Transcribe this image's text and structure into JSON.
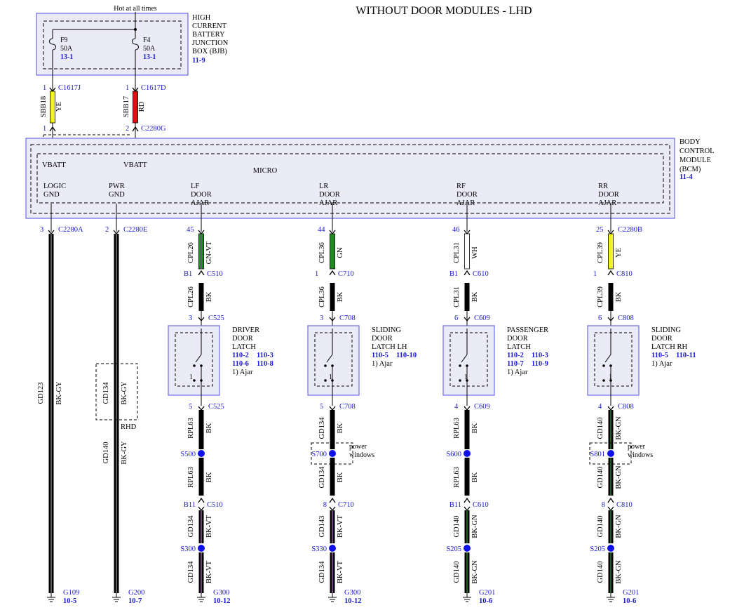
{
  "title": "WITHOUT DOOR MODULES - LHD",
  "hot_label": "Hot at all times",
  "colors": {
    "box_border": "#6a6ae6",
    "box_fill": "#ebebf7",
    "text_blue": "#1a1ad0",
    "splice": "#1010ee"
  },
  "bjb": {
    "name": [
      "HIGH",
      "CURRENT",
      "BATTERY",
      "JUNCTION",
      "BOX (BJB)"
    ],
    "ref": "11-9",
    "fuses": [
      {
        "id": "F9",
        "rating": "50A",
        "ref": "13-1"
      },
      {
        "id": "F4",
        "rating": "50A",
        "ref": "13-1"
      }
    ]
  },
  "feeds": [
    {
      "pin_top": "1",
      "conn_top": "C1617J",
      "circuit": "SBB18",
      "color": "YE",
      "pin_bot": "1",
      "conn_bot": ""
    },
    {
      "pin_top": "1",
      "conn_top": "C1617D",
      "circuit": "SBB17",
      "color": "RD",
      "pin_bot": "2",
      "conn_bot": "C2280G"
    }
  ],
  "bcm": {
    "name": [
      "BODY",
      "CONTROL",
      "MODULE",
      "(BCM)"
    ],
    "ref": "11-4",
    "micro": "MICRO",
    "vbatt": [
      "VBATT",
      "VBATT"
    ],
    "pins": [
      [
        "LOGIC",
        "GND"
      ],
      [
        "PWR",
        "GND"
      ],
      [
        "LF",
        "DOOR",
        "AJAR"
      ],
      [
        "LR",
        "DOOR",
        "AJAR"
      ],
      [
        "RF",
        "DOOR",
        "AJAR"
      ],
      [
        "RR",
        "DOOR",
        "AJAR"
      ]
    ]
  },
  "grounds": [
    {
      "pin": "3",
      "conn": "C2280A",
      "circuit": "GD123",
      "color": "BK-GY",
      "ground": "G109",
      "ref": "10-5"
    },
    {
      "pin": "2",
      "conn": "C2280E",
      "circuit": "GD140",
      "color": "BK-GY",
      "rhd_circuit": "GD134",
      "rhd_color": "BK-GY",
      "rhd_label": "RHD",
      "ground": "G200",
      "ref": "10-7"
    }
  ],
  "columns": [
    {
      "bcm_pin": "45",
      "bcm_wire": {
        "circuit": "CPL26",
        "color": "GN-VT"
      },
      "c1_pin": "B1",
      "c1": "C510",
      "w2": {
        "circuit": "CPL26",
        "color": "BK"
      },
      "latch_pin_top": "3",
      "latch_conn": "C525",
      "latch_name": [
        "DRIVER",
        "DOOR",
        "LATCH"
      ],
      "latch_refs": [
        [
          "110-2",
          "110-3"
        ],
        [
          "110-6",
          "110-8"
        ]
      ],
      "ajar_note": "1) Ajar",
      "switch_label": "1",
      "latch_pin_bot": "5",
      "latch_conn_bot": "C525",
      "w3": {
        "circuit": "RPL63",
        "color": "BK"
      },
      "splice": "S500",
      "splice_note": "",
      "w4": {
        "circuit": "RPL63",
        "color": "BK"
      },
      "c2_pin": "B11",
      "c2": "C510",
      "w5": {
        "circuit": "GD134",
        "color": "BK-VT"
      },
      "splice2": "S300",
      "w6": {
        "circuit": "GD134",
        "color": "BK-VT"
      },
      "ground": "G300",
      "ground_ref": "10-12"
    },
    {
      "bcm_pin": "44",
      "bcm_wire": {
        "circuit": "CPL36",
        "color": "GN"
      },
      "c1_pin": "1",
      "c1": "C710",
      "w2": {
        "circuit": "CPL36",
        "color": "BK"
      },
      "latch_pin_top": "3",
      "latch_conn": "C708",
      "latch_name": [
        "SLIDING",
        "DOOR",
        "LATCH LH"
      ],
      "latch_refs": [
        [
          "110-5",
          "110-10"
        ]
      ],
      "ajar_note": "1) Ajar",
      "switch_label": "1",
      "latch_pin_bot": "5",
      "latch_conn_bot": "C708",
      "w3": {
        "circuit": "GD134",
        "color": "BK"
      },
      "splice": "S700",
      "splice_note": [
        "power",
        "windows"
      ],
      "w4": {
        "circuit": "GD134",
        "color": "BK"
      },
      "c2_pin": "8",
      "c2": "C710",
      "w5": {
        "circuit": "GD143",
        "color": "BK-VT"
      },
      "splice2": "S330",
      "w6": {
        "circuit": "GD134",
        "color": "BK-VT"
      },
      "ground": "G300",
      "ground_ref": "10-12"
    },
    {
      "bcm_pin": "46",
      "bcm_wire": {
        "circuit": "CPL31",
        "color": "WH"
      },
      "c1_pin": "B1",
      "c1": "C610",
      "w2": {
        "circuit": "CPL31",
        "color": "BK"
      },
      "latch_pin_top": "6",
      "latch_conn": "C609",
      "latch_name": [
        "PASSENGER",
        "DOOR",
        "LATCH"
      ],
      "latch_refs": [
        [
          "110-2",
          "110-3"
        ],
        [
          "110-7",
          "110-9"
        ]
      ],
      "ajar_note": "1) Ajar",
      "switch_label": "1",
      "latch_pin_bot": "4",
      "latch_conn_bot": "C609",
      "w3": {
        "circuit": "RPL63",
        "color": "BK"
      },
      "splice": "S600",
      "splice_note": "",
      "w4": {
        "circuit": "RPL63",
        "color": "BK"
      },
      "c2_pin": "B11",
      "c2": "C610",
      "w5": {
        "circuit": "GD140",
        "color": "BK-GN"
      },
      "splice2": "S205",
      "w6": {
        "circuit": "GD140",
        "color": "BK-GN"
      },
      "ground": "G201",
      "ground_ref": "10-6"
    },
    {
      "bcm_pin": "25",
      "bcm_wire": {
        "circuit": "CPL39",
        "color": "YE"
      },
      "c1_pin": "1",
      "c1": "C810",
      "w2": {
        "circuit": "CPL39",
        "color": "BK"
      },
      "latch_pin_top": "6",
      "latch_conn": "C808",
      "latch_name": [
        "SLIDING",
        "DOOR",
        "LATCH RH"
      ],
      "latch_refs": [
        [
          "110-5",
          "110-11"
        ]
      ],
      "ajar_note": "1) Ajar",
      "switch_label": "1",
      "latch_pin_bot": "4",
      "latch_conn_bot": "C808",
      "w3": {
        "circuit": "GD140",
        "color": "BK-GN"
      },
      "splice": "S801",
      "splice_note": [
        "power",
        "windows"
      ],
      "w4": {
        "circuit": "GD140",
        "color": "BK-GN"
      },
      "c2_pin": "8",
      "c2": "C810",
      "w5": {
        "circuit": "GD140",
        "color": "BK-GN"
      },
      "splice2": "S205",
      "w6": {
        "circuit": "GD140",
        "color": "BK-GN"
      },
      "ground": "G201",
      "ground_ref": "10-6"
    }
  ],
  "bcm_conn_right": "C2280B"
}
